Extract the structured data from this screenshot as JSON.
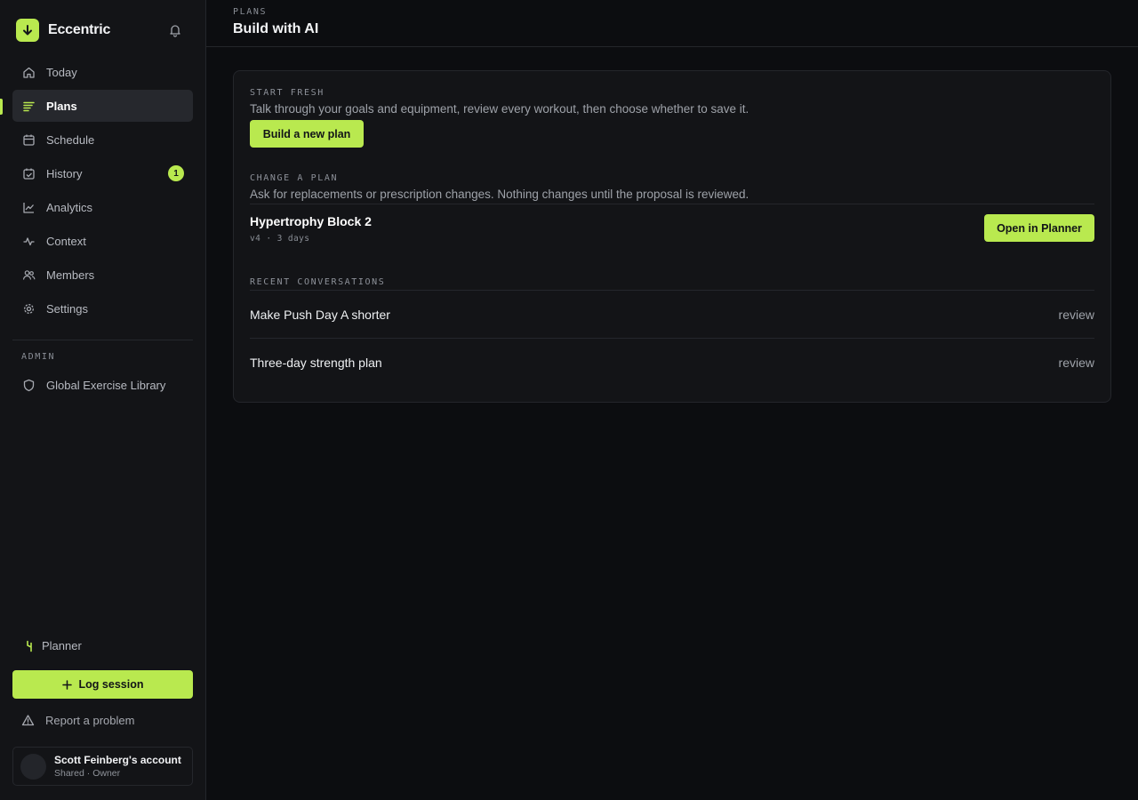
{
  "app": {
    "name": "Eccentric"
  },
  "sidebar": {
    "items": [
      {
        "label": "Today",
        "icon": "home-icon"
      },
      {
        "label": "Plans",
        "icon": "list-icon",
        "active": true
      },
      {
        "label": "Schedule",
        "icon": "calendar-icon"
      },
      {
        "label": "History",
        "icon": "calendar-check-icon",
        "badge": "1"
      },
      {
        "label": "Analytics",
        "icon": "chart-line-icon"
      },
      {
        "label": "Context",
        "icon": "pulse-icon"
      },
      {
        "label": "Members",
        "icon": "users-icon"
      },
      {
        "label": "Settings",
        "icon": "gear-icon"
      }
    ],
    "admin_label": "ADMIN",
    "admin_item": {
      "label": "Global Exercise Library",
      "icon": "shield-icon"
    },
    "planner_label": "Planner",
    "log_session_label": "Log session",
    "report_label": "Report a problem",
    "account": {
      "name": "Scott Feinberg's account",
      "subtitle": "Shared · Owner"
    }
  },
  "header": {
    "eyebrow": "PLANS",
    "title": "Build with AI"
  },
  "main": {
    "start_fresh": {
      "label": "START FRESH",
      "description": "Talk through your goals and equipment, review every workout, then choose whether to save it.",
      "button": "Build a new plan"
    },
    "change_plan": {
      "label": "CHANGE A PLAN",
      "description": "Ask for replacements or prescription changes. Nothing changes until the proposal is reviewed.",
      "plan_name": "Hypertrophy Block 2",
      "plan_meta": "v4 · 3 days",
      "button": "Open in Planner"
    },
    "recent": {
      "label": "RECENT CONVERSATIONS",
      "items": [
        {
          "title": "Make Push Day A shorter",
          "status": "review"
        },
        {
          "title": "Three-day strength plan",
          "status": "review"
        }
      ]
    }
  },
  "colors": {
    "accent": "#b9e94f",
    "background": "#0c0d10",
    "sidebar": "#131417"
  }
}
